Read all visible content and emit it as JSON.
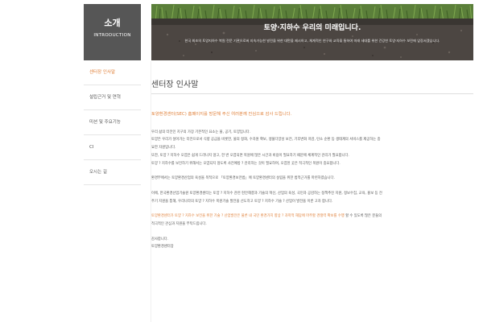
{
  "sidebar": {
    "title": "소개",
    "subtitle": "INTRODUCTION",
    "items": [
      {
        "label": "센터장 인사말",
        "active": true
      },
      {
        "label": "설립근거 및 연혁",
        "active": false
      },
      {
        "label": "미션 및 주요기능",
        "active": false
      },
      {
        "label": "CI",
        "active": false
      },
      {
        "label": "오시는 길",
        "active": false
      }
    ]
  },
  "banner": {
    "headline": "토양·지하수 우리의 미래입니다.",
    "subline": "한국 최초의 토양지하수 복원 전문 기관으로써 지속가능한 발전을 위한 대안을 제시하고, 체계적인 연구와 교육을 통하여 미래 세대를 위한 건강한 토양·지하수 보전에 앞장서겠습니다."
  },
  "page": {
    "title": "센터장 인사말"
  },
  "content": {
    "lead": "토양환경센터(SEC) 홈페이지를 방문해 주신 여러분께 진심으로 감사 드립니다.",
    "p1": [
      "우리 삶의 터전인 지구의 가장 기본적인 요소는 물, 공기, 토양입니다.",
      "토양은 우리가 살아가는 터전으로서 식량 공급을 비롯한, 물의 정화, 수자원 확보, 생물다양성 보전, 기후변화 저감, 탄소 순환 등 생태계의 서비스를 제공하는 중",
      "요한 자원입니다.",
      "또한, 토양 ? 지하수 오염은 쉽게 드러나지 않고, 한 번 오염되면 복원에 많은 시간과 비용이 필요하기 때문에 체계적인 관리가 필요합니다.",
      "토양 ? 지하수를 보전하기 위해서는 오염되지 않도록 사전예방 ? 관리하는 것이 필요하며, 오염된 곳은 적극적인 복원이 중요합니다."
    ],
    "p2": "환경부에서는 토양환경산업의 육성을 목적으로 「토양환경보전법」에 토양환경센터의 설립을 위한 법적근거를 마련하였습니다.",
    "p3": [
      "이에, 한국환경산업기술원 토양환경센터는 토양 ? 지하수 관련 현안해결과 기술의 혁신, 산업의 육성, 국민과 공감하는 정책추진 지원, 정보수집, 교육, 홍보 등 전",
      "주기 지원을 통해, 우리나라의 토양 ? 지하수 복원기술 발전을 선도하고 토양 ? 지하수 기술 ? 산업이 발전을 이룬 고자 합니다."
    ],
    "p4_prefix": "토양환경센터가 ",
    "p4_orange": "토양 ? 지하수 보전을 위한 기술 ? 산업발전은 물론 내 국민 환경가치 향상 ? 과학적 해답에 마주할 경쟁력 확보를 수행",
    "p4_suffix": " 할 수 있도록 많은 분들의",
    "p4_line2": "적극적인 관심과 지원을 부탁드립니다.",
    "closing": "감사합니다.",
    "signature": "토양환경센터장"
  }
}
